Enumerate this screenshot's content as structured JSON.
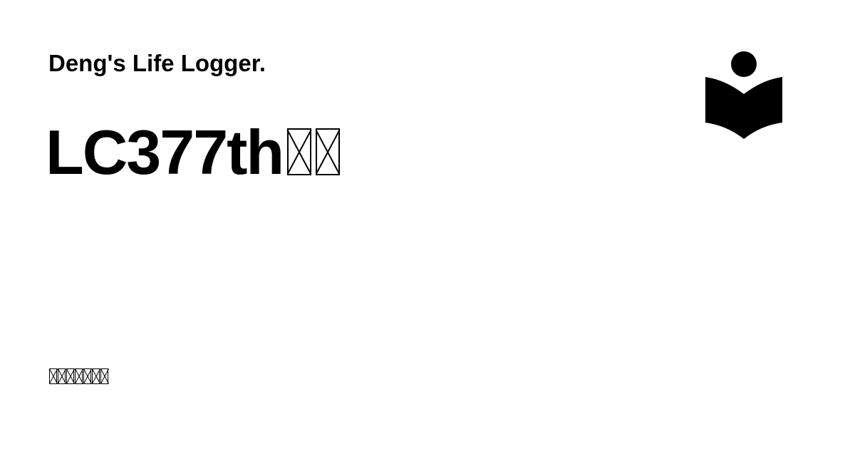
{
  "site": {
    "name": "Deng's Life Logger."
  },
  "post": {
    "title": "LC377th",
    "title_unrendered_glyph_count": 2,
    "subtitle_unrendered_glyph_count": 7
  },
  "logo": {
    "icon": "book-reader-icon",
    "color": "#000000"
  },
  "colors": {
    "background": "#ffffff",
    "text": "#000000"
  }
}
